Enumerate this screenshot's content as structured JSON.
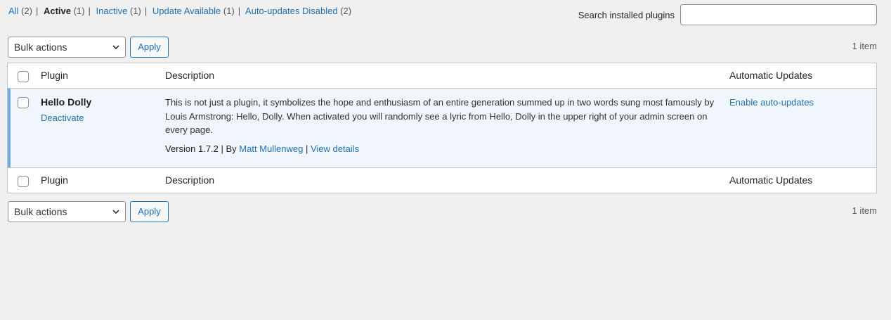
{
  "filters": [
    {
      "label": "All",
      "count": "(2)",
      "current": false
    },
    {
      "label": "Active",
      "count": "(1)",
      "current": true
    },
    {
      "label": "Inactive",
      "count": "(1)",
      "current": false
    },
    {
      "label": "Update Available",
      "count": "(1)",
      "current": false
    },
    {
      "label": "Auto-updates Disabled",
      "count": "(2)",
      "current": false
    }
  ],
  "search": {
    "label": "Search installed plugins",
    "value": "",
    "placeholder": ""
  },
  "tablenav": {
    "bulk_actions": "Bulk actions",
    "apply": "Apply",
    "items_count": "1 item"
  },
  "columns": {
    "plugin": "Plugin",
    "description": "Description",
    "auto_updates": "Automatic Updates"
  },
  "plugin": {
    "name": "Hello Dolly",
    "action": "Deactivate",
    "description": "This is not just a plugin, it symbolizes the hope and enthusiasm of an entire generation summed up in two words sung most famously by Louis Armstrong: Hello, Dolly. When activated you will randomly see a lyric from Hello, Dolly in the upper right of your admin screen on every page.",
    "version_text": "Version 1.7.2 | By ",
    "author": "Matt Mullenweg",
    "separator": " | ",
    "details_link": "View details",
    "auto_update_link": "Enable auto-updates"
  },
  "colors": {
    "link": "#2271b1",
    "active_border": "#72aee6",
    "active_row_bg": "#f0f6fc"
  }
}
